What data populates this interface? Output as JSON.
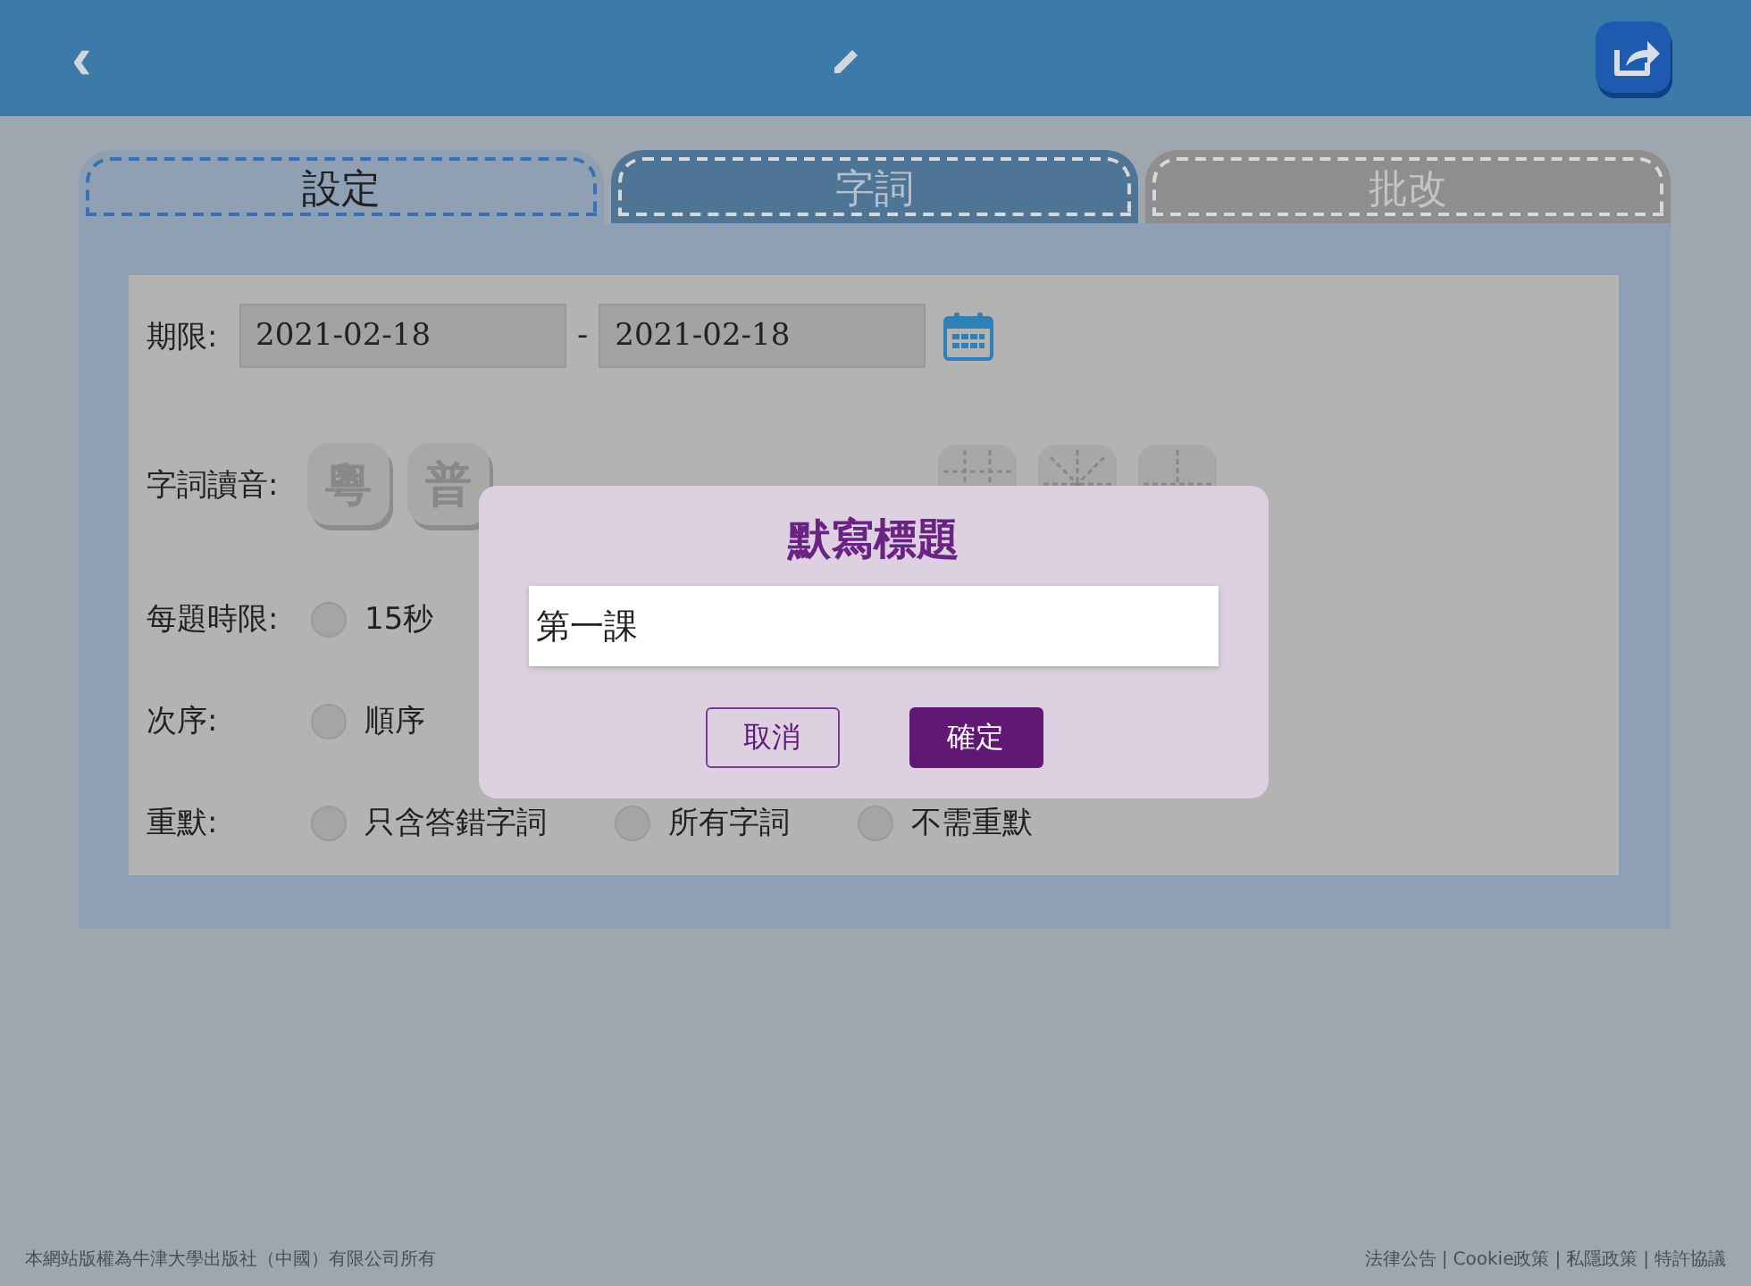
{
  "header": {
    "back": "‹"
  },
  "tabs": [
    {
      "label": "設定",
      "selected": true
    },
    {
      "label": "字詞",
      "selected": false
    },
    {
      "label": "批改",
      "selected": false
    }
  ],
  "deadline": {
    "label": "期限:",
    "start": "2021-02-18",
    "separator": "-",
    "end": "2021-02-18"
  },
  "pronunciation": {
    "label": "字詞讀音:",
    "options": [
      {
        "label": "粵"
      },
      {
        "label": "普"
      }
    ]
  },
  "grid_lines": {
    "options": [
      {
        "kind": "grid"
      },
      {
        "kind": "star"
      },
      {
        "kind": "cross"
      }
    ]
  },
  "time_limit": {
    "label": "每題時限:",
    "options": [
      {
        "label": "15秒",
        "selected": false
      }
    ]
  },
  "order": {
    "label": "次序:",
    "options": [
      {
        "label": "順序",
        "selected": false
      }
    ]
  },
  "redo": {
    "label": "重默:",
    "options": [
      {
        "label": "只含答錯字詞",
        "selected": false
      },
      {
        "label": "所有字詞",
        "selected": false
      },
      {
        "label": "不需重默",
        "selected": false
      }
    ]
  },
  "dialog": {
    "title": "默寫標題",
    "value": "第一課",
    "buttons": [
      {
        "label": "取消",
        "kind": "secondary"
      },
      {
        "label": "確定",
        "kind": "primary"
      }
    ]
  },
  "footer": {
    "copyright": "本網站版權為牛津大學出版社（中國）有限公司所有",
    "links": [
      "法律公告",
      "Cookie政策",
      "私隱政策",
      "特許協議"
    ],
    "separator": "|"
  }
}
